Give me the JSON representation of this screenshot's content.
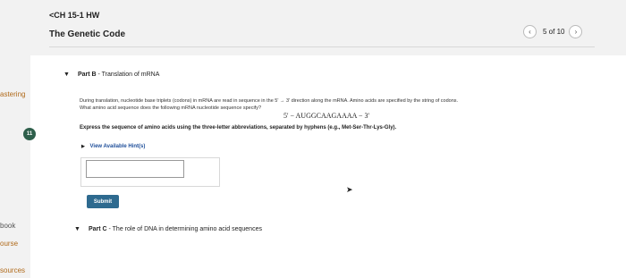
{
  "sidebar": {
    "items": [
      {
        "label": "astering"
      },
      {
        "label": "book"
      },
      {
        "label": "ourse"
      },
      {
        "label": "sources"
      }
    ],
    "badge": "11"
  },
  "header": {
    "breadcrumb": "<CH 15-1 HW",
    "title": "The Genetic Code",
    "pager": {
      "prev_icon": "chevron-left-icon",
      "next_icon": "chevron-right-icon",
      "count": "5 of 10"
    }
  },
  "partB": {
    "caret": "▼",
    "label": "Part B",
    "title": " - Translation of mRNA",
    "description_line1": "During translation, nucleotide base triplets (codons) in mRNA are read in sequence in the 5' → 3' direction along the mRNA. Amino acids are specified by the string of codons.",
    "description_line2": "What amino acid sequence does the following mRNA nucleotide sequence specify?",
    "sequence": "5' − AUGGCAAGAAAA − 3'",
    "instruction": "Express the sequence of amino acids using the three-letter abbreviations, separated by hyphens (e.g., Met-Ser-Thr-Lys-Gly).",
    "hint_caret": "▶",
    "hint_label": "View Available Hint(s)",
    "answer_value": "",
    "submit_label": "Submit"
  },
  "partC": {
    "caret": "▼",
    "label": "Part C",
    "title": " - The role of DNA in determining amino acid sequences"
  },
  "colors": {
    "accent": "#2e6a8f",
    "hint_link": "#1f4f9a",
    "sidebar_text": "#b06a1a",
    "badge": "#2e5f4b"
  }
}
